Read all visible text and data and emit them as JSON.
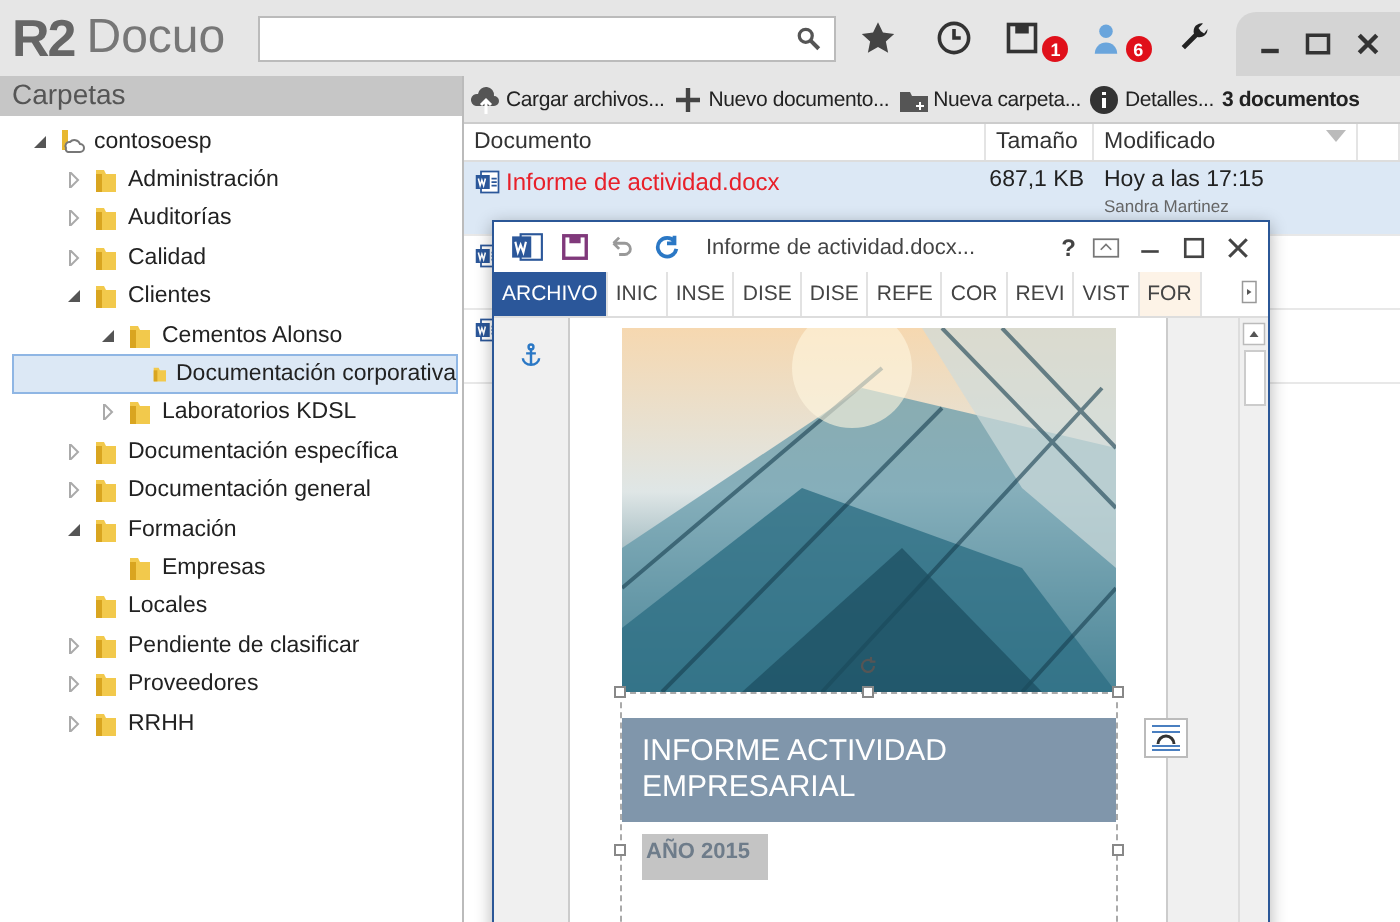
{
  "app": {
    "logo_mark": "R2",
    "logo_text": "Docuo"
  },
  "toolbar_badges": [
    {
      "kind": "save",
      "badge": "1"
    },
    {
      "kind": "user",
      "badge": "6"
    }
  ],
  "sidebar": {
    "title": "Carpetas",
    "tree": [
      {
        "label": "contosoesp",
        "kind": "root",
        "expanded": true,
        "selected": false,
        "children": [
          {
            "label": "Administración",
            "kind": "branch",
            "expanded": false,
            "selected": false
          },
          {
            "label": "Auditorías",
            "kind": "branch",
            "expanded": false,
            "selected": false
          },
          {
            "label": "Calidad",
            "kind": "branch",
            "expanded": false,
            "selected": false
          },
          {
            "label": "Clientes",
            "kind": "branch",
            "expanded": true,
            "selected": false,
            "children": [
              {
                "label": "Cementos Alonso",
                "kind": "branch",
                "expanded": true,
                "selected": false,
                "children": [
                  {
                    "label": "Documentación corporativa",
                    "kind": "leaf",
                    "selected": true
                  }
                ]
              },
              {
                "label": "Laboratorios KDSL",
                "kind": "branch",
                "expanded": false,
                "selected": false
              }
            ]
          },
          {
            "label": "Documentación específica",
            "kind": "branch",
            "expanded": false,
            "selected": false
          },
          {
            "label": "Documentación general",
            "kind": "branch",
            "expanded": false,
            "selected": false
          },
          {
            "label": "Formación",
            "kind": "branch",
            "expanded": true,
            "selected": false,
            "children": [
              {
                "label": "Empresas",
                "kind": "leaf",
                "selected": false
              }
            ]
          },
          {
            "label": "Locales",
            "kind": "leaf",
            "selected": false
          },
          {
            "label": "Pendiente de clasificar",
            "kind": "branch",
            "expanded": false,
            "selected": false
          },
          {
            "label": "Proveedores",
            "kind": "branch",
            "expanded": false,
            "selected": false
          },
          {
            "label": "RRHH",
            "kind": "branch",
            "expanded": false,
            "selected": false
          }
        ]
      }
    ]
  },
  "actions": [
    {
      "kind": "upload",
      "label": "Cargar archivos..."
    },
    {
      "kind": "new",
      "label": "Nuevo documento..."
    },
    {
      "kind": "folder",
      "label": "Nueva carpeta..."
    },
    {
      "kind": "info",
      "label": "Detalles..."
    }
  ],
  "document_count": "3 documentos",
  "table": {
    "columns": [
      "Documento",
      "Tamaño",
      "Modificado"
    ],
    "rows": [
      {
        "selected": true,
        "name": "Informe de actividad.docx",
        "size": "687,1 KB",
        "modified": "Hoy a las 17:15",
        "author": "Sandra Martinez"
      },
      {
        "selected": false
      },
      {
        "selected": false
      }
    ]
  },
  "word_window": {
    "title": "Informe de actividad.docx...",
    "help": "?",
    "tabs": [
      {
        "label": "ARCHIVO",
        "kind": "file"
      },
      {
        "label": "INIC",
        "kind": "tab"
      },
      {
        "label": "INSE",
        "kind": "tab"
      },
      {
        "label": "DISE",
        "kind": "tab"
      },
      {
        "label": "DISE",
        "kind": "tab"
      },
      {
        "label": "REFE",
        "kind": "tab"
      },
      {
        "label": "COR",
        "kind": "tab"
      },
      {
        "label": "REVI",
        "kind": "tab"
      },
      {
        "label": "VIST",
        "kind": "tab"
      },
      {
        "label": "FOR",
        "kind": "contextual"
      }
    ],
    "document": {
      "title": "INFORME ACTIVIDAD EMPRESARIAL",
      "year": "AÑO 2015"
    }
  }
}
